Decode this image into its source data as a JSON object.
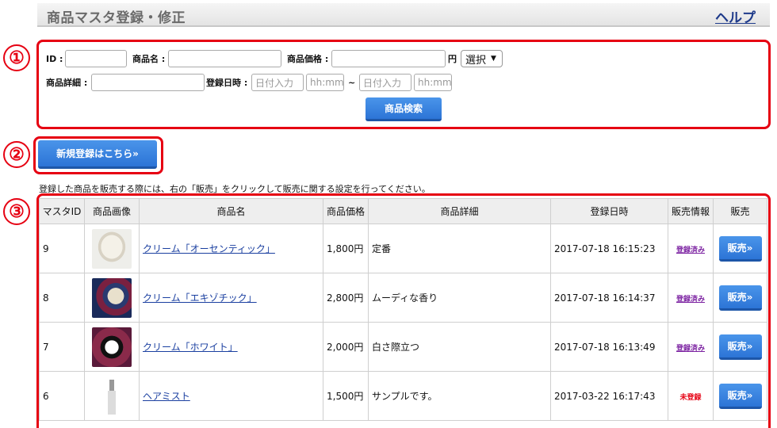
{
  "header": {
    "title": "商品マスタ登録・修正",
    "help": "ヘルプ"
  },
  "markers": [
    "①",
    "②",
    "③"
  ],
  "search": {
    "id_label": "ID :",
    "name_label": "商品名 :",
    "price_label": "商品価格 :",
    "price_unit": "円",
    "price_select": "選択",
    "detail_label": "商品詳細 :",
    "date_label": "登録日時 :",
    "date_placeholder": "日付入力",
    "time_placeholder": "hh:mm",
    "tilde": "~",
    "search_button": "商品検索"
  },
  "new_button": "新規登録はこちら»",
  "notice": "登録した商品を販売する際には、右の「販売」をクリックして販売に関する設定を行ってください。",
  "table": {
    "headers": [
      "マスタID",
      "商品画像",
      "商品名",
      "商品価格",
      "商品詳細",
      "登録日時",
      "販売情報",
      "販売"
    ],
    "sell_label": "販売»",
    "rows": [
      {
        "id": "9",
        "image": "cream-jar-white-image",
        "name": "クリーム「オーセンティック」",
        "price": "1,800円",
        "detail": "定番",
        "date": "2017-07-18 16:15:23",
        "status": "登録済み",
        "registered": true
      },
      {
        "id": "8",
        "image": "cream-jar-exotic-image",
        "name": "クリーム「エキゾチック」",
        "price": "2,800円",
        "detail": "ムーディな香り",
        "date": "2017-07-18 16:14:37",
        "status": "登録済み",
        "registered": true
      },
      {
        "id": "7",
        "image": "cream-jar-white-dark-image",
        "name": "クリーム「ホワイト」",
        "price": "2,000円",
        "detail": "白さ際立つ",
        "date": "2017-07-18 16:13:49",
        "status": "登録済み",
        "registered": true
      },
      {
        "id": "6",
        "image": "hair-mist-bottle-image",
        "name": "ヘアミスト",
        "price": "1,500円",
        "detail": "サンプルです。",
        "date": "2017-03-22 16:17:43",
        "status": "未登録",
        "registered": false
      }
    ]
  },
  "colors": {
    "accent_red": "#e60012",
    "button_blue": "#2c74d6",
    "link_blue": "#1a3fa0",
    "status_purple": "#7a1fa0"
  }
}
